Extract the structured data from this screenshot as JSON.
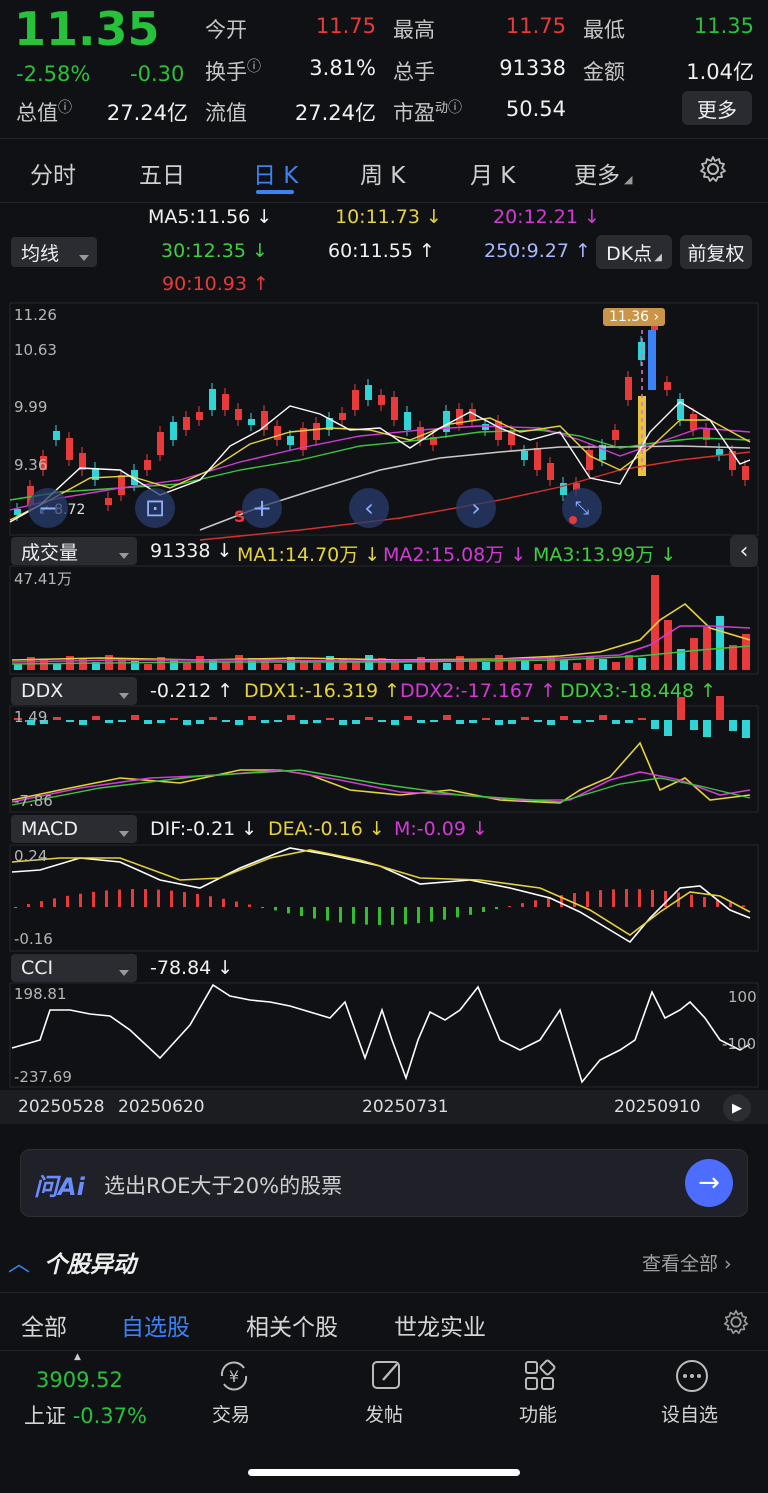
{
  "quote": {
    "price": "11.35",
    "change_pct": "-2.58%",
    "change": "-0.30",
    "open_label": "今开",
    "open": "11.75",
    "high_label": "最高",
    "high": "11.75",
    "low_label": "最低",
    "low": "11.35",
    "turnover_label": "换手",
    "turnover": "3.81%",
    "volume_label": "总手",
    "volume": "91338",
    "amount_label": "金额",
    "amount": "1.04亿",
    "mktcap_label": "总值",
    "mktcap": "27.24亿",
    "float_label": "流值",
    "float": "27.24亿",
    "pe_label": "市盈",
    "pe_sup": "动",
    "pe": "50.54",
    "more_button": "更多"
  },
  "period_tabs": [
    "分时",
    "五日",
    "日 K",
    "周 K",
    "月 K",
    "更多"
  ],
  "active_tab": "日 K",
  "ma_bar": {
    "selector": "均线",
    "ma5": "MA5:11.56 ↓",
    "ma10": "10:11.73 ↓",
    "ma20": "20:12.21 ↓",
    "ma30": "30:12.35 ↓",
    "ma60": "60:11.55 ↑",
    "ma250": "250:9.27 ↑",
    "ma90": "90:10.93 ↑",
    "dk_button": "DK点",
    "fq_button": "前复权"
  },
  "kline": {
    "y_labels": [
      "11.26",
      "10.63",
      "9.99",
      "9.36",
      "8.72"
    ],
    "low_marker": "8.72",
    "high_marker": "11.36",
    "s_marker": "S"
  },
  "volume_panel": {
    "selector": "成交量",
    "value": "91338 ↓",
    "ma1": "MA1:14.70万 ↓",
    "ma2": "MA2:15.08万 ↓",
    "ma3": "MA3:13.99万 ↓",
    "y_top": "47.41万"
  },
  "ddx_panel": {
    "selector": "DDX",
    "value": "-0.212 ↑",
    "ddx1": "DDX1:-16.319 ↑",
    "ddx2": "DDX2:-17.167 ↑",
    "ddx3": "DDX3:-18.448 ↑",
    "y_top": "1.49",
    "y_bottom": "-7.86"
  },
  "macd_panel": {
    "selector": "MACD",
    "dif": "DIF:-0.21 ↓",
    "dea": "DEA:-0.16 ↓",
    "m": "M:-0.09 ↓",
    "y_top": "0.24",
    "y_bottom": "-0.16"
  },
  "cci_panel": {
    "selector": "CCI",
    "value": "-78.84 ↓",
    "y_top": "198.81",
    "y_bottom": "-237.69",
    "ref_high": "100",
    "ref_low": "-100"
  },
  "dates": [
    "20250528",
    "20250620",
    "20250731",
    "20250910"
  ],
  "ai_bar": {
    "brand": "问Ai",
    "prompt": "选出ROE大于20%的股票"
  },
  "anomaly": {
    "title": "个股异动",
    "view_all": "查看全部"
  },
  "bottom_tabs": [
    "全部",
    "自选股",
    "相关个股",
    "世龙实业"
  ],
  "bottom_active": "自选股",
  "index": {
    "value": "3909.52",
    "name": "上证",
    "change": "-0.37%"
  },
  "nav": [
    {
      "label": "交易",
      "icon": "yuan-exchange-icon"
    },
    {
      "label": "发帖",
      "icon": "edit-icon"
    },
    {
      "label": "功能",
      "icon": "grid-icon"
    },
    {
      "label": "设自选",
      "icon": "more-dots-icon"
    }
  ],
  "colors": {
    "up": "#e83a3a",
    "down": "#27c23c",
    "accent": "#3b82f6",
    "bg": "#101114"
  }
}
